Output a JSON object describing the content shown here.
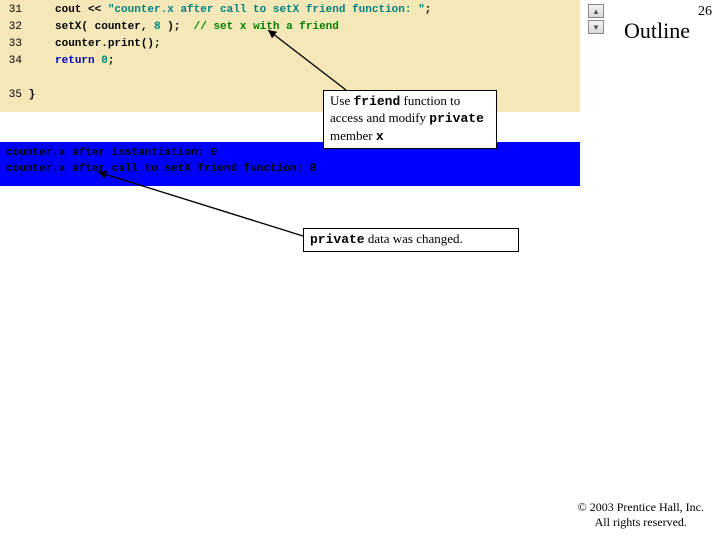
{
  "page_number": "26",
  "outline_title": "Outline",
  "code": {
    "l31": {
      "n": "31",
      "pre": "     cout << ",
      "str": "\"counter.x after call to setX friend function: \"",
      "post": ";"
    },
    "l32": {
      "n": "32",
      "pre": "     setX( counter, ",
      "num": "8",
      "mid": " );  ",
      "cm": "// set x with a friend"
    },
    "l33": {
      "n": "33",
      "pre": "     counter.print();"
    },
    "l34": {
      "n": "34",
      "kw": "return",
      "mid": " ",
      "num": "0",
      "post": ";"
    },
    "l35": {
      "n": "35",
      "pre": " }"
    }
  },
  "output": {
    "line1": "counter.x after instantiation: 0",
    "line2": "counter.x after call to setX friend function: 8"
  },
  "callout1": {
    "t1": "Use ",
    "m1": "friend",
    "t2": " function to access and modify ",
    "m2": "private",
    "t3": " member ",
    "m3": "x"
  },
  "callout2": {
    "m1": "private",
    "t1": " data was changed."
  },
  "copyright": {
    "line1": "© 2003 Prentice Hall, Inc.",
    "line2": "All rights reserved."
  },
  "nav": {
    "up": "▲",
    "down": "▼"
  }
}
